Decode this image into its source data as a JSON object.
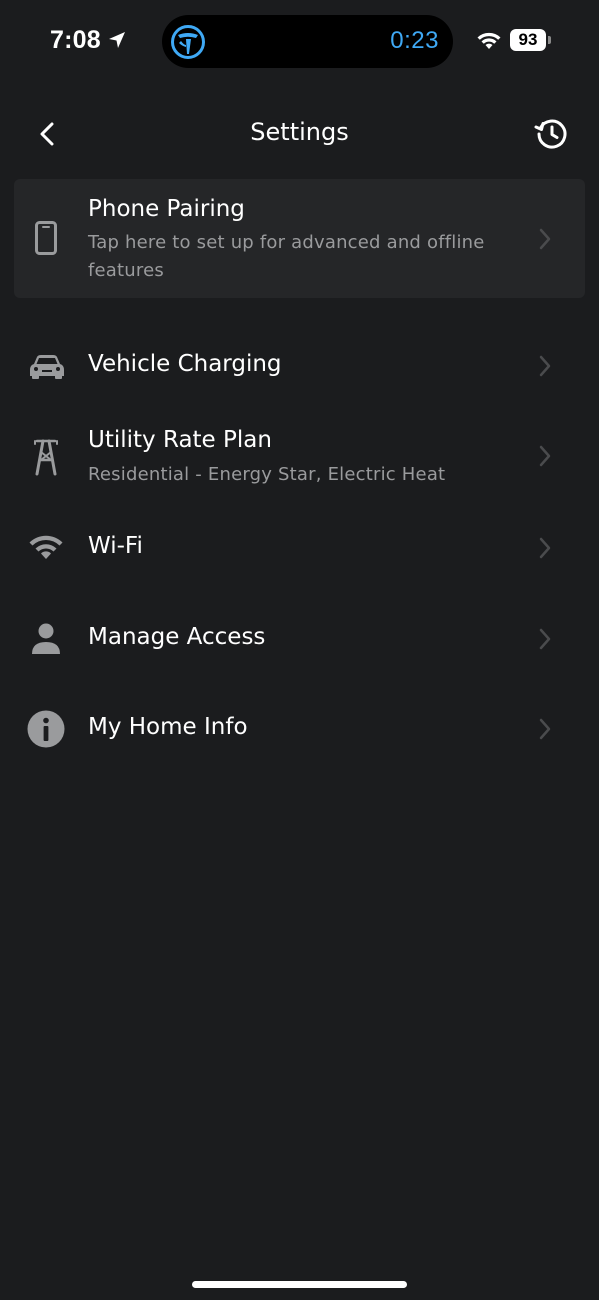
{
  "status_bar": {
    "time": "7:08",
    "timer": "0:23",
    "battery": "93",
    "timer_color": "#3fa9f5"
  },
  "header": {
    "title": "Settings",
    "back_icon": "chevron-left-icon",
    "history_icon": "history-icon"
  },
  "settings": [
    {
      "title": "Phone Pairing",
      "subtitle": "Tap here to set up for advanced and offline features",
      "icon": "phone-icon",
      "highlighted": true
    },
    {
      "title": "Vehicle Charging",
      "subtitle": "",
      "icon": "car-icon"
    },
    {
      "title": "Utility Rate Plan",
      "subtitle": "Residential - Energy Star, Electric Heat",
      "icon": "power-tower-icon"
    },
    {
      "title": "Wi-Fi",
      "subtitle": "",
      "icon": "wifi-icon"
    },
    {
      "title": "Manage Access",
      "subtitle": "",
      "icon": "person-icon"
    },
    {
      "title": "My Home Info",
      "subtitle": "",
      "icon": "info-icon"
    }
  ],
  "colors": {
    "background": "#1b1c1e",
    "highlight_row": "#252628",
    "subtitle_text": "#9a9b9d",
    "icon_gray": "#9a9b9d",
    "chevron_gray": "#4a4b4d"
  }
}
